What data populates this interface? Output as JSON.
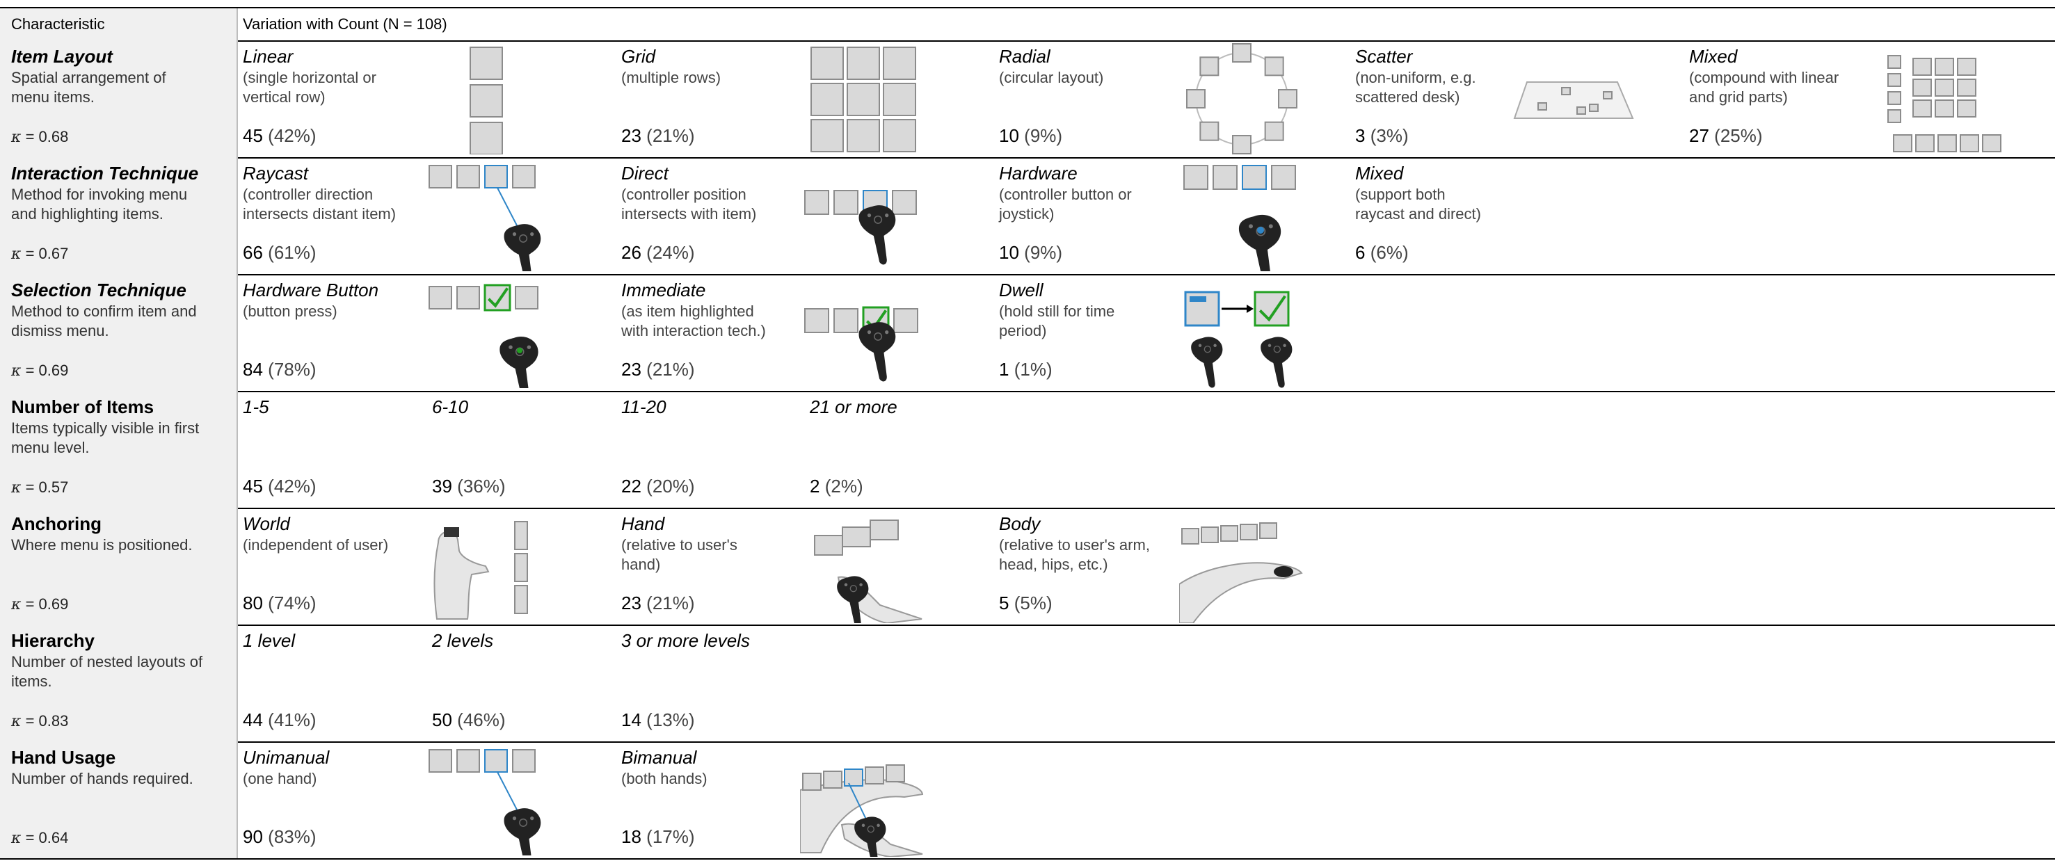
{
  "header": {
    "characteristic": "Characteristic",
    "variation": "Variation with Count (N = 108)"
  },
  "rows": [
    {
      "name": "Item Layout",
      "desc": [
        "Spatial arrangement of",
        "menu items."
      ],
      "kappa_symbol": "κ",
      "kappa": "= 0.68",
      "categories": [
        {
          "label": "Linear",
          "desc": [
            "(single horizontal or",
            "vertical row)"
          ],
          "count": "45",
          "pct": "(42%)",
          "icon": "linear-layout-icon"
        },
        {
          "label": "Grid",
          "desc": [
            "(multiple rows)"
          ],
          "count": "23",
          "pct": "(21%)",
          "icon": "grid-layout-icon"
        },
        {
          "label": "Radial",
          "desc": [
            "(circular layout)"
          ],
          "count": "10",
          "pct": "(9%)",
          "icon": "radial-layout-icon"
        },
        {
          "label": "Scatter",
          "desc": [
            "(non-uniform, e.g.",
            "scattered desk)"
          ],
          "count": "3",
          "pct": "(3%)",
          "icon": "scatter-layout-icon"
        },
        {
          "label": "Mixed",
          "desc": [
            "(compound with linear",
            "and grid parts)"
          ],
          "count": "27",
          "pct": "(25%)",
          "icon": "mixed-layout-icon"
        }
      ]
    },
    {
      "name": "Interaction Technique",
      "desc": [
        "Method for invoking menu",
        "and highlighting items."
      ],
      "kappa_symbol": "κ",
      "kappa": "= 0.67",
      "categories": [
        {
          "label": "Raycast",
          "desc": [
            "(controller direction",
            "intersects distant item)"
          ],
          "count": "66",
          "pct": "(61%)",
          "icon": "raycast-icon"
        },
        {
          "label": "Direct",
          "desc": [
            "(controller position",
            "intersects with item)"
          ],
          "count": "26",
          "pct": "(24%)",
          "icon": "direct-icon"
        },
        {
          "label": "Hardware",
          "desc": [
            "(controller button or",
            "joystick)"
          ],
          "count": "10",
          "pct": "(9%)",
          "icon": "hardware-icon"
        },
        {
          "label": "Mixed",
          "desc": [
            "(support both",
            "raycast and direct)"
          ],
          "count": "6",
          "pct": "(6%)",
          "icon": ""
        }
      ]
    },
    {
      "name": "Selection Technique",
      "desc": [
        "Method to confirm item and",
        "dismiss menu."
      ],
      "kappa_symbol": "κ",
      "kappa": "= 0.69",
      "categories": [
        {
          "label": "Hardware Button",
          "desc": [
            "(button press)"
          ],
          "count": "84",
          "pct": "(78%)",
          "icon": "hardware-button-icon"
        },
        {
          "label": "Immediate",
          "desc": [
            "(as item highlighted",
            "with interaction tech.)"
          ],
          "count": "23",
          "pct": "(21%)",
          "icon": "immediate-icon"
        },
        {
          "label": "Dwell",
          "desc": [
            "(hold still for time",
            "period)"
          ],
          "count": "1",
          "pct": "(1%)",
          "icon": "dwell-icon"
        }
      ]
    },
    {
      "name": "Number of Items",
      "desc": [
        "Items typically visible in first",
        "menu level."
      ],
      "kappa_symbol": "κ",
      "kappa": "= 0.57",
      "categories": [
        {
          "label": "1-5",
          "desc": [],
          "count": "45",
          "pct": "(42%)",
          "icon": ""
        },
        {
          "label": "6-10",
          "desc": [],
          "count": "39",
          "pct": "(36%)",
          "icon": ""
        },
        {
          "label": "11-20",
          "desc": [],
          "count": "22",
          "pct": "(20%)",
          "icon": ""
        },
        {
          "label": "21 or more",
          "desc": [],
          "count": "2",
          "pct": "(2%)",
          "icon": ""
        }
      ]
    },
    {
      "name": "Anchoring",
      "desc": [
        "Where menu is positioned."
      ],
      "kappa_symbol": "κ",
      "kappa": "= 0.69",
      "categories": [
        {
          "label": "World",
          "desc": [
            "(independent of user)"
          ],
          "count": "80",
          "pct": "(74%)",
          "icon": "world-anchor-icon"
        },
        {
          "label": "Hand",
          "desc": [
            "(relative to user's",
            "hand)"
          ],
          "count": "23",
          "pct": "(21%)",
          "icon": "hand-anchor-icon"
        },
        {
          "label": "Body",
          "desc": [
            "(relative to user's arm,",
            "head, hips, etc.)"
          ],
          "count": "5",
          "pct": "(5%)",
          "icon": "body-anchor-icon"
        }
      ]
    },
    {
      "name": "Hierarchy",
      "desc": [
        "Number of nested layouts of",
        "items."
      ],
      "kappa_symbol": "κ",
      "kappa": "= 0.83",
      "categories": [
        {
          "label": "1 level",
          "desc": [],
          "count": "44",
          "pct": "(41%)",
          "icon": ""
        },
        {
          "label": "2 levels",
          "desc": [],
          "count": "50",
          "pct": "(46%)",
          "icon": ""
        },
        {
          "label": "3 or more levels",
          "desc": [],
          "count": "14",
          "pct": "(13%)",
          "icon": ""
        }
      ]
    },
    {
      "name": "Hand Usage",
      "desc": [
        "Number of hands required."
      ],
      "kappa_symbol": "κ",
      "kappa": "= 0.64",
      "categories": [
        {
          "label": "Unimanual",
          "desc": [
            "(one hand)"
          ],
          "count": "90",
          "pct": "(83%)",
          "icon": "unimanual-icon"
        },
        {
          "label": "Bimanual",
          "desc": [
            "(both hands)"
          ],
          "count": "18",
          "pct": "(17%)",
          "icon": "bimanual-icon"
        }
      ]
    }
  ],
  "colors": {
    "item_fill": "#d9d9d9",
    "item_stroke": "#8c8c8c",
    "highlight": "#2f86c8",
    "check": "#22a022",
    "controller": "#222222",
    "label_bg": "#f0f0f0"
  }
}
